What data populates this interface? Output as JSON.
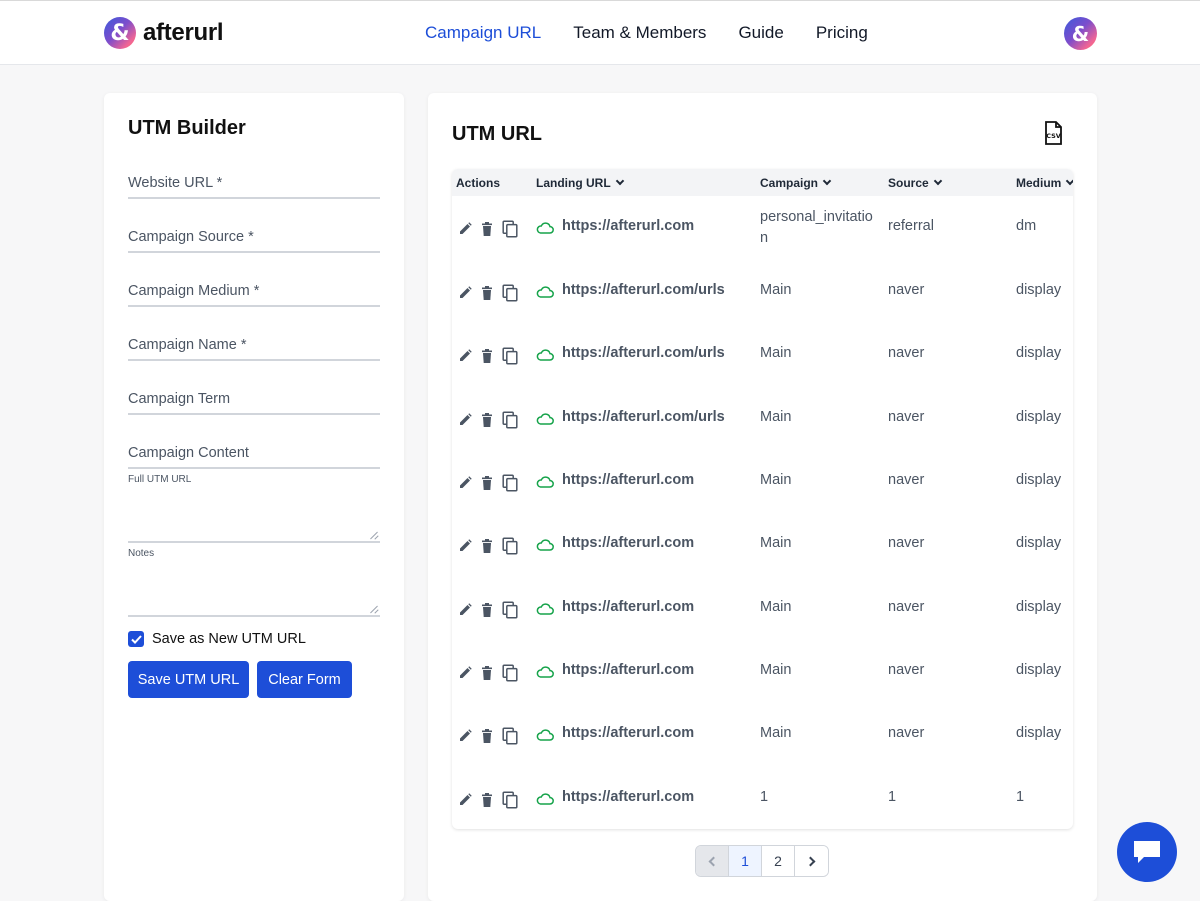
{
  "header": {
    "logo_symbol": "&",
    "logo_text": "afterurl",
    "nav": [
      {
        "label": "Campaign URL",
        "active": true
      },
      {
        "label": "Team & Members",
        "active": false
      },
      {
        "label": "Guide",
        "active": false
      },
      {
        "label": "Pricing",
        "active": false
      }
    ],
    "avatar_symbol": "&"
  },
  "builder": {
    "title": "UTM Builder",
    "fields": {
      "website_url": "Website URL *",
      "campaign_source": "Campaign Source *",
      "campaign_medium": "Campaign Medium *",
      "campaign_name": "Campaign Name *",
      "campaign_term": "Campaign Term",
      "campaign_content": "Campaign Content"
    },
    "full_url_label": "Full UTM URL",
    "notes_label": "Notes",
    "save_new_label": "Save as New UTM URL",
    "save_new_checked": true,
    "save_button": "Save UTM URL",
    "clear_button": "Clear Form"
  },
  "table_panel": {
    "title": "UTM URL",
    "csv_icon": "csv-file-icon",
    "columns": {
      "actions": "Actions",
      "landing_url": "Landing URL",
      "campaign": "Campaign",
      "source": "Source",
      "medium": "Medium"
    },
    "rows": [
      {
        "url": "https://afterurl.com",
        "campaign": "personal_invitatio",
        "campaign_cont": "n",
        "source": "referral",
        "medium": "dm"
      },
      {
        "url": "https://afterurl.com/urls",
        "campaign": "Main",
        "campaign_cont": "",
        "source": "naver",
        "medium": "display"
      },
      {
        "url": "https://afterurl.com/urls",
        "campaign": "Main",
        "campaign_cont": "",
        "source": "naver",
        "medium": "display"
      },
      {
        "url": "https://afterurl.com/urls",
        "campaign": "Main",
        "campaign_cont": "",
        "source": "naver",
        "medium": "display"
      },
      {
        "url": "https://afterurl.com",
        "campaign": "Main",
        "campaign_cont": "",
        "source": "naver",
        "medium": "display"
      },
      {
        "url": "https://afterurl.com",
        "campaign": "Main",
        "campaign_cont": "",
        "source": "naver",
        "medium": "display"
      },
      {
        "url": "https://afterurl.com",
        "campaign": "Main",
        "campaign_cont": "",
        "source": "naver",
        "medium": "display"
      },
      {
        "url": "https://afterurl.com",
        "campaign": "Main",
        "campaign_cont": "",
        "source": "naver",
        "medium": "display"
      },
      {
        "url": "https://afterurl.com",
        "campaign": "Main",
        "campaign_cont": "",
        "source": "naver",
        "medium": "display"
      },
      {
        "url": "https://afterurl.com",
        "campaign": "1",
        "campaign_cont": "",
        "source": "1",
        "medium": "1"
      }
    ],
    "pagination": {
      "pages": [
        "1",
        "2"
      ],
      "current": "1"
    }
  },
  "colors": {
    "accent": "#1d4ed8",
    "cloud": "#16a34a"
  }
}
